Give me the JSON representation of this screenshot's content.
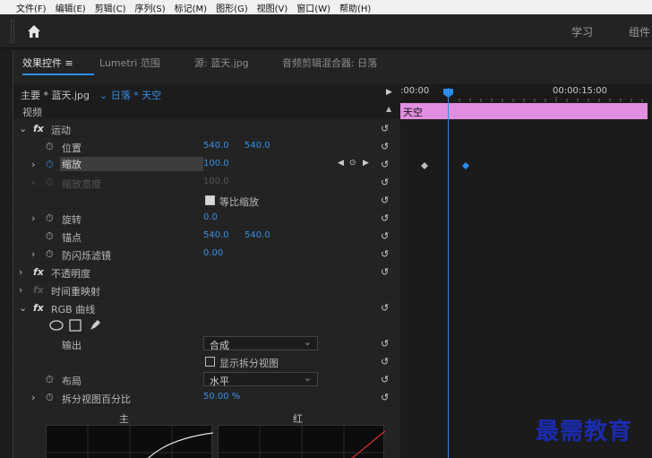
{
  "menu": [
    "文件(F)",
    "编辑(E)",
    "剪辑(C)",
    "序列(S)",
    "标记(M)",
    "图形(G)",
    "视图(V)",
    "窗口(W)",
    "帮助(H)"
  ],
  "workspaces": {
    "learn": "学习",
    "assembly": "组件"
  },
  "tabs": {
    "effect_controls": "效果控件",
    "lumetri": "Lumetri 范围",
    "source": "源: 蓝天.jpg",
    "audio_mixer": "音频剪辑混合器: 日落"
  },
  "header": {
    "master": "主要 * 蓝天.jpg",
    "sequence": "日落 * 天空",
    "time_start": ":00:00",
    "time_mid": "00:00:15:00"
  },
  "clip": {
    "name": "天空"
  },
  "effects": {
    "video_label": "视频",
    "motion": "运动",
    "position": {
      "label": "位置",
      "x": "540.0",
      "y": "540.0"
    },
    "scale": {
      "label": "缩放",
      "value": "100.0"
    },
    "scale_width": {
      "label": "缩放宽度",
      "value": "100.0"
    },
    "uniform_scale": "等比缩放",
    "rotation": {
      "label": "旋转",
      "value": "0.0"
    },
    "anchor": {
      "label": "锚点",
      "x": "540.0",
      "y": "540.0"
    },
    "anti_flicker": {
      "label": "防闪烁滤镜",
      "value": "0.00"
    },
    "opacity": "不透明度",
    "time_remap": "时间重映射",
    "rgb_curves": "RGB 曲线",
    "output": {
      "label": "输出",
      "value": "合成"
    },
    "show_split": "显示拆分视图",
    "layout": {
      "label": "布局",
      "value": "水平"
    },
    "split_percent": {
      "label": "拆分视图百分比",
      "value": "50.00 %"
    },
    "graph_master": "主要",
    "graph_red": "红色"
  },
  "watermark": "最需教育",
  "colors": {
    "accent": "#2d8ceb",
    "clip": "#e28ee0",
    "value_blue": "#3a8fe6"
  }
}
